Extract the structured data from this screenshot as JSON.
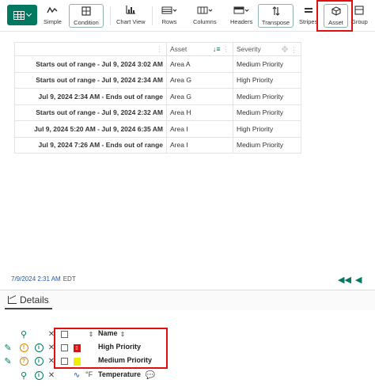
{
  "toolbar": {
    "buttons": [
      {
        "label": "Simple",
        "icon": "line-chart-icon"
      },
      {
        "label": "Condition",
        "icon": "condition-icon"
      },
      {
        "label": "Chart View",
        "icon": "bar-chart-icon"
      },
      {
        "label": "Rows",
        "icon": "rows-icon"
      },
      {
        "label": "Columns",
        "icon": "columns-icon"
      },
      {
        "label": "Headers",
        "icon": "headers-icon"
      },
      {
        "label": "Transpose",
        "icon": "transpose-icon"
      },
      {
        "label": "Stripes",
        "icon": "stripes-icon"
      },
      {
        "label": "Asset",
        "icon": "cube-icon"
      },
      {
        "label": "Group",
        "icon": "group-icon"
      }
    ]
  },
  "table": {
    "columns": [
      {
        "label": ""
      },
      {
        "label": "Asset"
      },
      {
        "label": "Severity"
      }
    ],
    "rows": [
      {
        "capsule": "Starts out of range - Jul 9, 2024 3:02 AM",
        "asset": "Area A",
        "severity": "Medium Priority"
      },
      {
        "capsule": "Starts out of range - Jul 9, 2024 2:34 AM",
        "asset": "Area G",
        "severity": "High Priority"
      },
      {
        "capsule": "Jul 9, 2024 2:34 AM - Ends out of range",
        "asset": "Area G",
        "severity": "Medium Priority"
      },
      {
        "capsule": "Starts out of range - Jul 9, 2024 2:32 AM",
        "asset": "Area H",
        "severity": "Medium Priority"
      },
      {
        "capsule": "Jul 9, 2024 5:20 AM - Jul 9, 2024 6:35 AM",
        "asset": "Area I",
        "severity": "High Priority"
      },
      {
        "capsule": "Jul 9, 2024 7:26 AM - Ends out of range",
        "asset": "Area I",
        "severity": "Medium Priority"
      }
    ]
  },
  "timebar": {
    "time": "7/9/2024 2:31 AM",
    "timezone": "EDT"
  },
  "details": {
    "tab_label": "Details",
    "header_name": "Name",
    "items": [
      {
        "name": "High Priority",
        "swatch_color": "#e01010"
      },
      {
        "name": "Medium Priority",
        "swatch_color": "#f3ee00"
      },
      {
        "name": "Temperature",
        "unit": "°F"
      }
    ]
  },
  "colors": {
    "accent": "#007960",
    "highlight": "#e01010"
  }
}
